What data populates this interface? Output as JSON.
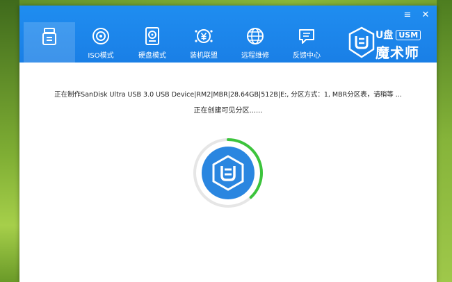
{
  "window": {
    "minimize_glyph": "≡",
    "close_glyph": "✕"
  },
  "nav": {
    "items": [
      {
        "label": "",
        "icon": "usb-drive-icon"
      },
      {
        "label": "ISO模式",
        "icon": "disc-icon"
      },
      {
        "label": "硬盘模式",
        "icon": "hard-drive-icon"
      },
      {
        "label": "装机联盟",
        "icon": "yen-coin-icon"
      },
      {
        "label": "远程维修",
        "icon": "globe-icon"
      },
      {
        "label": "反馈中心",
        "icon": "chat-bubble-icon"
      }
    ],
    "active_index": 0
  },
  "logo": {
    "text_top": "U盘",
    "badge": "USM",
    "text_bottom": "魔术师"
  },
  "status": {
    "line1": "正在制作SanDisk Ultra USB 3.0 USB Device|RM2|MBR|28.64GB|512B|E:,  分区方式：1,  MBR分区表，请稍等 ...",
    "line2": "正在创建可见分区......"
  },
  "progress": {
    "fraction": 0.38
  },
  "colors": {
    "titlebar": "#1a7fe6",
    "progress_green": "#3cc43c",
    "logo_blue": "#2a86e0"
  }
}
